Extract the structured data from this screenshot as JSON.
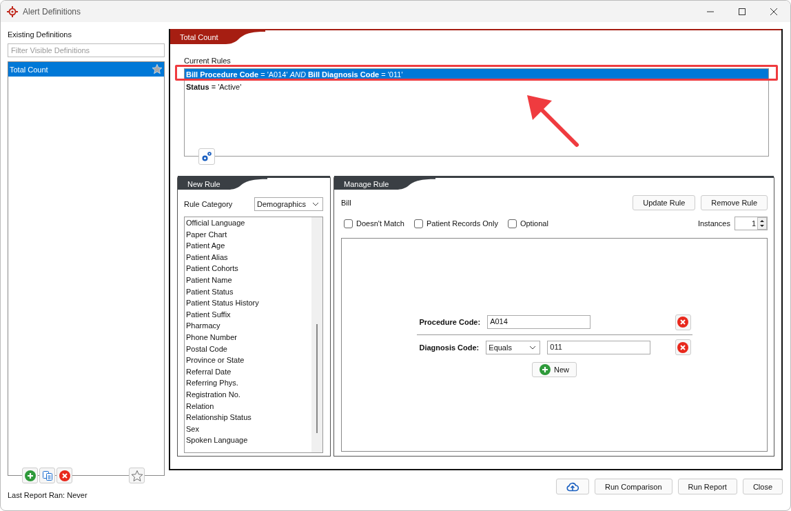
{
  "window": {
    "title": "Alert Definitions"
  },
  "definitions": {
    "label": "Existing Definitions",
    "filter_placeholder": "Filter Visible Definitions",
    "items": [
      {
        "label": "Total Count",
        "selected": true
      }
    ]
  },
  "last_report": "Last Report Ran: Never",
  "panel": {
    "title": "Total Count",
    "current_rules_label": "Current Rules",
    "rules": [
      {
        "text": "**Bill Procedure Code** = 'A014' *AND* **Bill Diagnosis Code** = '011'",
        "selected": true
      },
      {
        "text": "**Status** = 'Active'",
        "selected": false
      }
    ]
  },
  "new_rule": {
    "title": "New Rule",
    "category_label": "Rule Category",
    "category_value": "Demographics",
    "items": [
      "Official Language",
      "Paper Chart",
      "Patient Age",
      "Patient Alias",
      "Patient Cohorts",
      "Patient Name",
      "Patient Status",
      "Patient Status History",
      "Patient Suffix",
      "Pharmacy",
      "Phone Number",
      "Postal Code",
      "Province or State",
      "Referral Date",
      "Referring Phys.",
      "Registration No.",
      "Relation",
      "Relationship Status",
      "Sex",
      "Spoken Language"
    ]
  },
  "manage_rule": {
    "title": "Manage Rule",
    "rule_name": "Bill",
    "buttons": [
      "Update Rule",
      "Remove Rule"
    ],
    "options": [
      {
        "label": "Doesn't Match",
        "checked": false
      },
      {
        "label": "Patient Records Only",
        "checked": false
      },
      {
        "label": "Optional",
        "checked": false
      }
    ],
    "instances_label": "Instances",
    "instances_value": "1",
    "conditions": [
      {
        "kind": "text",
        "label": "Procedure Code:",
        "value": "A014"
      },
      {
        "kind": "operator",
        "label": "Diagnosis Code:",
        "operator": "Equals",
        "value": "011"
      }
    ],
    "new_button": "New"
  },
  "footer_buttons": [
    "Run Comparison",
    "Run Report",
    "Close"
  ]
}
